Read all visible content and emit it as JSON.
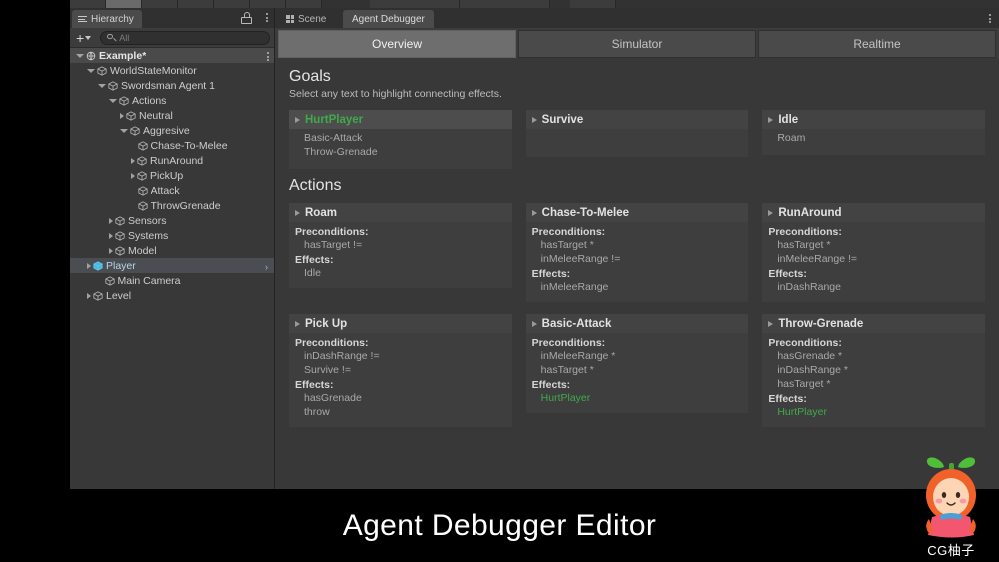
{
  "window": {
    "title": "Agent Debugger Editor"
  },
  "hierarchy": {
    "tab_label": "Hierarchy",
    "lock_icon": "lock-icon",
    "menu_icon": "kebab-menu-icon",
    "create_label": "+",
    "search_placeholder": "All",
    "search_value": "",
    "search_icon": "search-icon",
    "tree": [
      {
        "label": "Example*",
        "depth": 0,
        "state": "open",
        "icon": "scene-icon",
        "selected": false,
        "root": true,
        "more": true
      },
      {
        "label": "WorldStateMonitor",
        "depth": 1,
        "state": "open",
        "icon": "gameobject-icon",
        "selected": false
      },
      {
        "label": "Swordsman Agent 1",
        "depth": 2,
        "state": "open",
        "icon": "gameobject-icon",
        "selected": false
      },
      {
        "label": "Actions",
        "depth": 3,
        "state": "open",
        "icon": "gameobject-icon",
        "selected": false
      },
      {
        "label": "Neutral",
        "depth": 4,
        "state": "closed",
        "icon": "gameobject-icon",
        "selected": false
      },
      {
        "label": "Aggresive",
        "depth": 4,
        "state": "open",
        "icon": "gameobject-icon",
        "selected": false
      },
      {
        "label": "Chase-To-Melee",
        "depth": 5,
        "state": "leaf",
        "icon": "gameobject-icon",
        "selected": false
      },
      {
        "label": "RunAround",
        "depth": 5,
        "state": "closed",
        "icon": "gameobject-icon",
        "selected": false
      },
      {
        "label": "PickUp",
        "depth": 5,
        "state": "closed",
        "icon": "gameobject-icon",
        "selected": false
      },
      {
        "label": "Attack",
        "depth": 5,
        "state": "leaf",
        "icon": "gameobject-icon",
        "selected": false
      },
      {
        "label": "ThrowGrenade",
        "depth": 5,
        "state": "leaf",
        "icon": "gameobject-icon",
        "selected": false
      },
      {
        "label": "Sensors",
        "depth": 3,
        "state": "closed",
        "icon": "gameobject-icon",
        "selected": false
      },
      {
        "label": "Systems",
        "depth": 3,
        "state": "closed",
        "icon": "gameobject-icon",
        "selected": false
      },
      {
        "label": "Model",
        "depth": 3,
        "state": "closed",
        "icon": "gameobject-icon",
        "selected": false
      },
      {
        "label": "Player",
        "depth": 1,
        "state": "closed",
        "icon": "prefab-icon",
        "selected": true,
        "chevron": "›"
      },
      {
        "label": "Main Camera",
        "depth": 2,
        "state": "leaf",
        "icon": "gameobject-icon",
        "selected": false
      },
      {
        "label": "Level",
        "depth": 1,
        "state": "closed",
        "icon": "gameobject-icon",
        "selected": false
      }
    ]
  },
  "editor": {
    "window_tabs": [
      {
        "label": "Scene",
        "icon": "scene-grid-icon",
        "active": false
      },
      {
        "label": "Agent Debugger",
        "icon": "",
        "active": true
      }
    ],
    "menu_icon": "kebab-menu-icon",
    "mode_tabs": [
      {
        "label": "Overview",
        "active": true
      },
      {
        "label": "Simulator",
        "active": false
      },
      {
        "label": "Realtime",
        "active": false
      }
    ],
    "goals_section": {
      "title": "Goals",
      "subtitle": "Select any text to highlight connecting effects.",
      "goals": [
        {
          "name": "HurtPlayer",
          "highlighted": true,
          "items": [
            "Basic-Attack",
            "Throw-Grenade"
          ]
        },
        {
          "name": "Survive",
          "highlighted": false,
          "items": []
        },
        {
          "name": "Idle",
          "highlighted": false,
          "items": [
            "Roam"
          ]
        }
      ]
    },
    "actions_section": {
      "title": "Actions",
      "precondition_label": "Preconditions:",
      "effects_label": "Effects:",
      "actions": [
        {
          "name": "Roam",
          "preconditions": [
            {
              "text": "hasTarget !=",
              "green": false
            }
          ],
          "effects": [
            {
              "text": "Idle",
              "green": false
            }
          ]
        },
        {
          "name": "Chase-To-Melee",
          "preconditions": [
            {
              "text": "hasTarget *",
              "green": false
            },
            {
              "text": "inMeleeRange !=",
              "green": false
            }
          ],
          "effects": [
            {
              "text": "inMeleeRange",
              "green": false
            }
          ]
        },
        {
          "name": "RunAround",
          "preconditions": [
            {
              "text": "hasTarget *",
              "green": false
            },
            {
              "text": "inMeleeRange !=",
              "green": false
            }
          ],
          "effects": [
            {
              "text": "inDashRange",
              "green": false
            }
          ]
        },
        {
          "name": "Pick Up",
          "preconditions": [
            {
              "text": "inDashRange !=",
              "green": false
            },
            {
              "text": "Survive !=",
              "green": false
            }
          ],
          "effects": [
            {
              "text": "hasGrenade",
              "green": false
            },
            {
              "text": "throw",
              "green": false
            }
          ]
        },
        {
          "name": "Basic-Attack",
          "preconditions": [
            {
              "text": "inMeleeRange *",
              "green": false
            },
            {
              "text": "hasTarget *",
              "green": false
            }
          ],
          "effects": [
            {
              "text": "HurtPlayer",
              "green": true
            }
          ]
        },
        {
          "name": "Throw-Grenade",
          "preconditions": [
            {
              "text": "hasGrenade *",
              "green": false
            },
            {
              "text": "inDashRange *",
              "green": false
            },
            {
              "text": "hasTarget *",
              "green": false
            }
          ],
          "effects": [
            {
              "text": "HurtPlayer",
              "green": true
            }
          ]
        }
      ]
    }
  },
  "watermark": {
    "text": "CG柚子",
    "icon": "mascot-logo"
  },
  "colors": {
    "accent_green": "#3faa4b",
    "panel_bg": "#383838",
    "card_bg": "#3e3e3e",
    "selected_row": "#4a4e52",
    "active_tab": "#6e6e6e"
  }
}
